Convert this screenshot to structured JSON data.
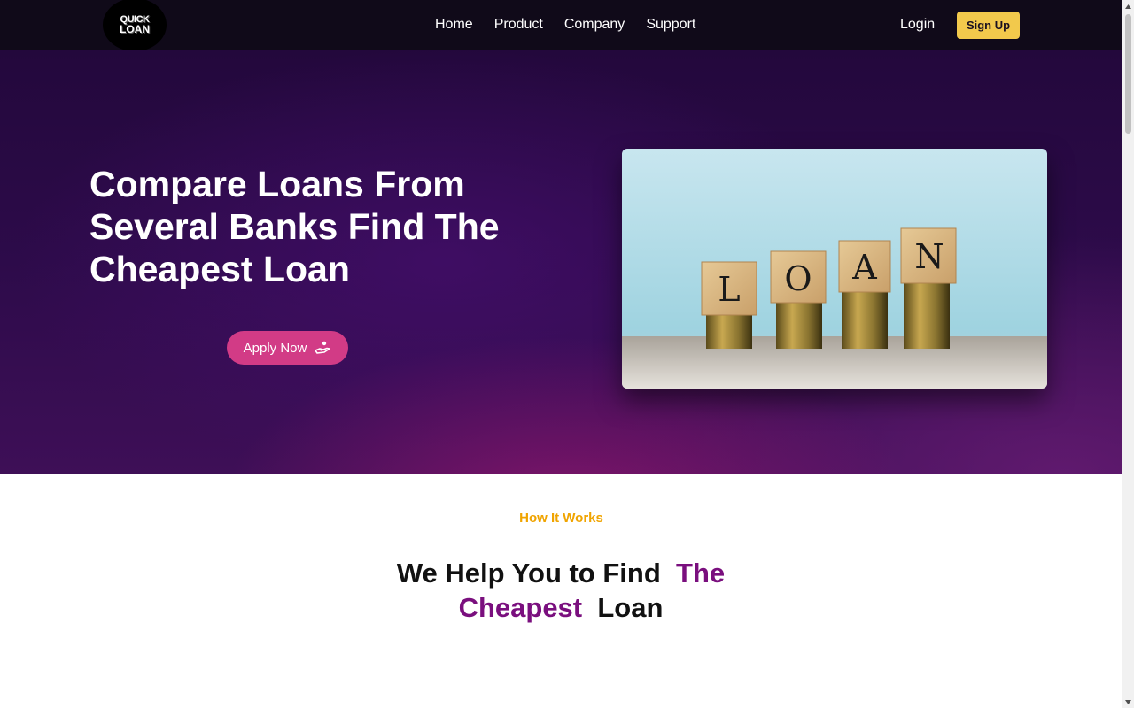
{
  "brand": {
    "logo_line1": "QUICK",
    "logo_line2": "LOAN"
  },
  "nav": {
    "links": [
      "Home",
      "Product",
      "Company",
      "Support"
    ],
    "login": "Login",
    "signup": "Sign Up"
  },
  "hero": {
    "title": "Compare Loans From Several Banks Find The Cheapest Loan",
    "apply_label": "Apply Now",
    "apply_icon": "hand-coin-icon",
    "image_blocks": [
      "L",
      "O",
      "A",
      "N"
    ]
  },
  "how": {
    "label": "How It Works",
    "title_part1": "We Help You to Find",
    "title_accent1": "The",
    "title_accent2": "Cheapest",
    "title_part2": "Loan"
  },
  "colors": {
    "nav_bg": "#100a19",
    "signup_bg": "#f2c94c",
    "apply_bg": "#d23b86",
    "label": "#f0a400",
    "accent": "#7a0f7e"
  }
}
